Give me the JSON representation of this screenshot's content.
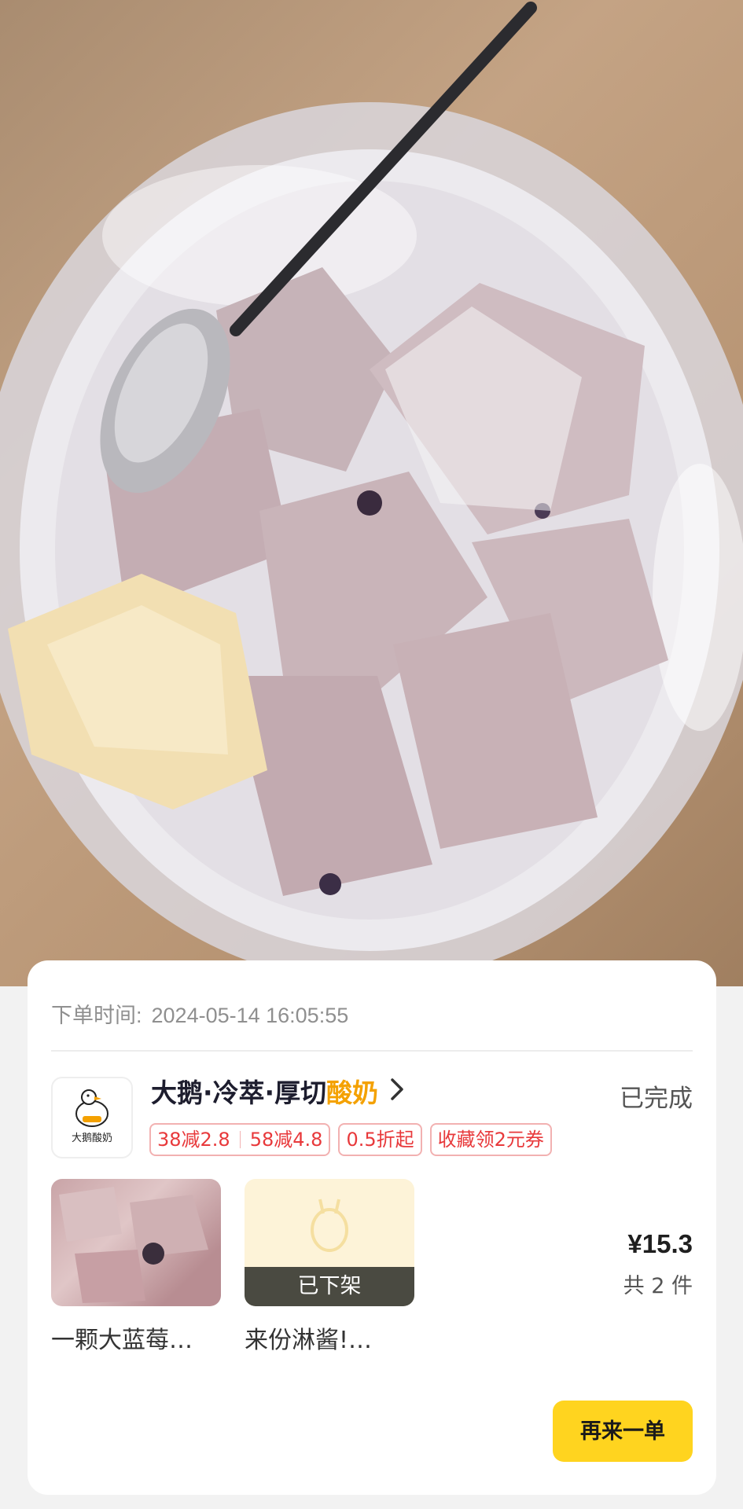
{
  "photo": {
    "icon": "yogurt-photo"
  },
  "order": {
    "time_label": "下单时间:",
    "time_value": "2024-05-14 16:05:55",
    "status": "已完成"
  },
  "shop": {
    "name_main": "大鹅·冷萃·厚切",
    "name_accent": "酸奶",
    "logo_text": "大鹅酸奶",
    "accent_color": "#f4a100"
  },
  "promos": {
    "p1a": "38减2.8",
    "p1b": "58减4.8",
    "p2": "0.5折起",
    "p3": "收藏领2元券"
  },
  "items": [
    {
      "name": "一颗大蓝莓…",
      "badge": ""
    },
    {
      "name": "来份淋酱!…",
      "badge": "已下架"
    }
  ],
  "summary": {
    "price": "¥15.3",
    "count": "共 2 件"
  },
  "actions": {
    "reorder": "再来一单",
    "button_color": "#ffd41f"
  }
}
